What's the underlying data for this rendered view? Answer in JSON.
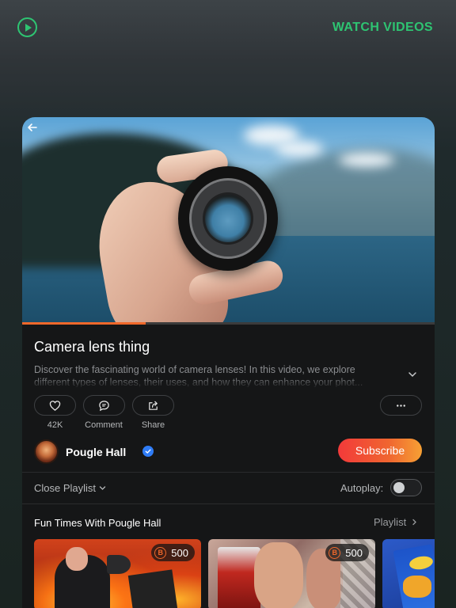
{
  "header": {
    "watch_videos_label": "WATCH VIDEOS",
    "accent_color": "#2ec472"
  },
  "video": {
    "title": "Camera lens thing",
    "description": "Discover the fascinating world of camera lenses! In this video, we explore different types of lenses, their uses, and how they can enhance your phot...",
    "progress_fraction": 0.3,
    "progress_color": "#f0682b"
  },
  "actions": {
    "likes_count": "42K",
    "comment_label": "Comment",
    "share_label": "Share"
  },
  "channel": {
    "name": "Pougle Hall",
    "verified": true,
    "subscribe_label": "Subscribe"
  },
  "playlist_controls": {
    "close_playlist_label": "Close Playlist",
    "autoplay_label": "Autoplay:",
    "autoplay_on": false
  },
  "playlist": {
    "title": "Fun Times With Pougle Hall",
    "link_label": "Playlist",
    "items": [
      {
        "price": "500",
        "coin_symbol": "B"
      },
      {
        "price": "500",
        "coin_symbol": "B"
      }
    ]
  }
}
